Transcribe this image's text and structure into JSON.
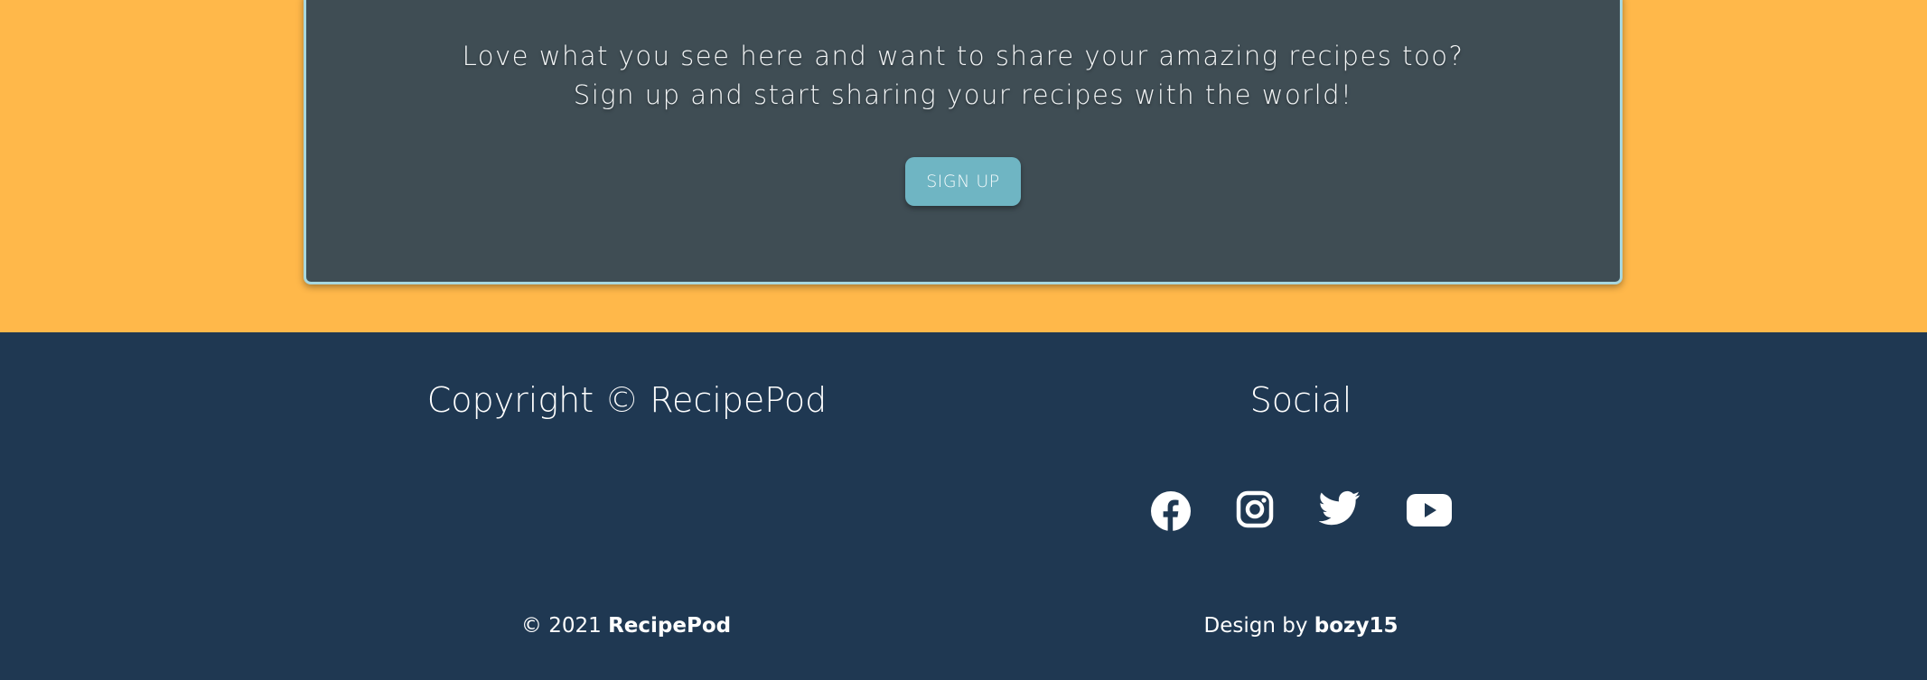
{
  "signup": {
    "line1": "Love what you see here and want to share your amazing recipes too?",
    "line2": "Sign up and start sharing your recipes with the world!",
    "button_label": "SIGN UP"
  },
  "footer": {
    "copyright_heading": "Copyright © RecipePod",
    "social_heading": "Social",
    "social_icons": [
      "facebook-icon",
      "instagram-icon",
      "twitter-icon",
      "youtube-icon"
    ],
    "copyright_prefix": "© 2021 ",
    "copyright_brand": "RecipePod",
    "design_prefix": "Design by ",
    "design_author": "bozy15"
  },
  "colors": {
    "page_accent": "#ffb84a",
    "card_background": "#3f4d54",
    "card_border": "#a8d7de",
    "button_background": "#6fb5c3",
    "footer_background": "#1f3852"
  }
}
